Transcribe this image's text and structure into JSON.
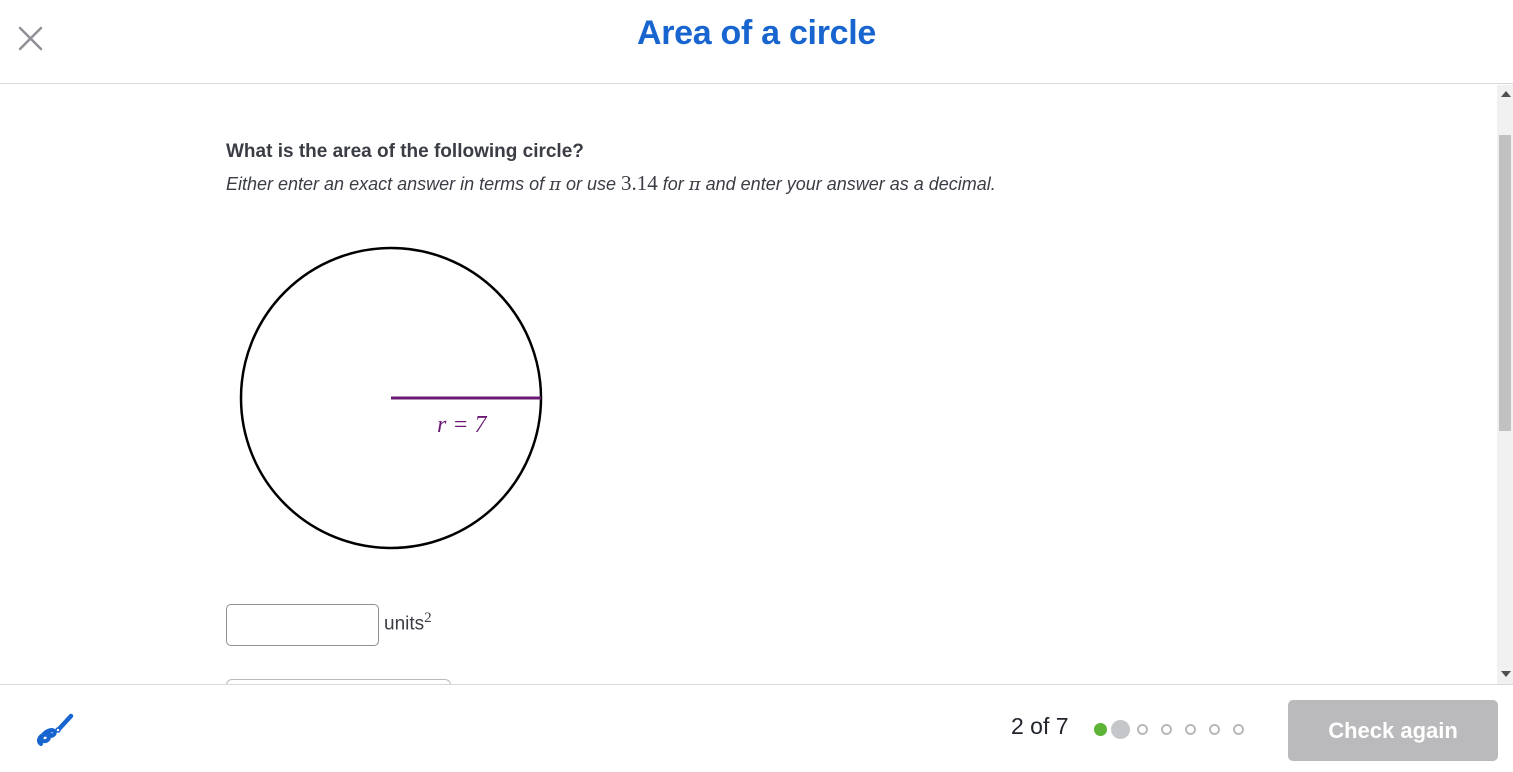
{
  "header": {
    "title": "Area of a circle"
  },
  "question": {
    "prompt": "What is the area of the following circle?",
    "instruction_part1": "Either enter an exact answer in terms of ",
    "pi": "π",
    "instruction_part2": " or use ",
    "pi_value": "3.14",
    "instruction_part3": " for ",
    "instruction_part4": " and enter your answer as a decimal."
  },
  "figure": {
    "radius_label": "r = 7",
    "radius_color": "#6b1a74"
  },
  "answer": {
    "value": "",
    "placeholder": "",
    "units": "units",
    "units_exponent": "2"
  },
  "footer": {
    "progress": "2 of 7",
    "current_step": 2,
    "total_steps": 7,
    "check_button_label": "Check again"
  },
  "colors": {
    "title": "#1865d0",
    "done_dot": "#5cb335",
    "button_disabled": "#bababd",
    "scratchpad_icon": "#1865d0"
  }
}
